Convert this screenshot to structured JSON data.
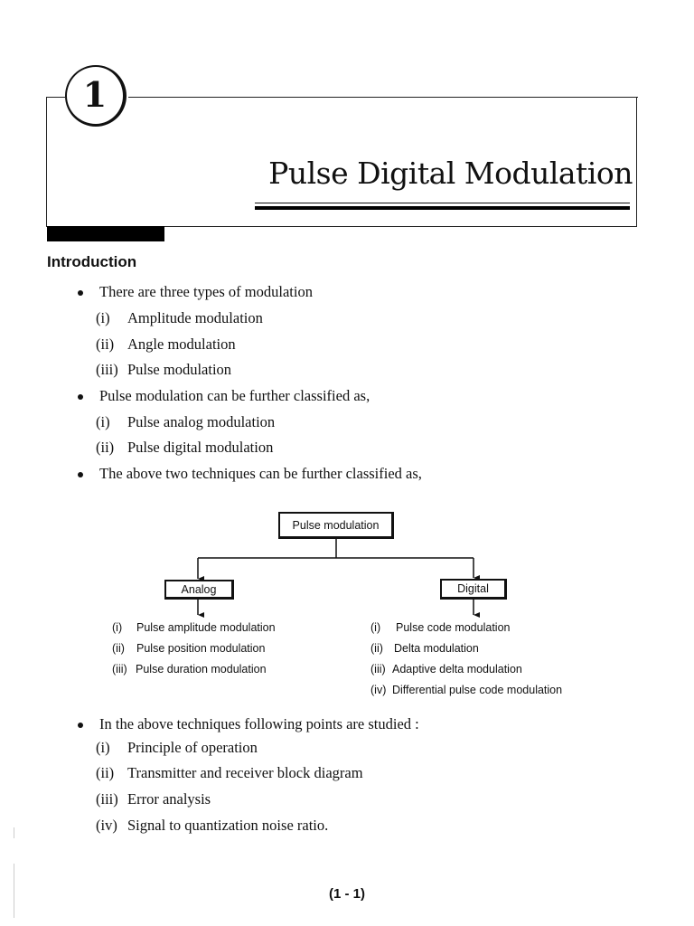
{
  "chapter": {
    "number": "1",
    "title": "Pulse Digital Modulation"
  },
  "introduction": {
    "heading": "Introduction",
    "bullets": [
      {
        "text": "There are three types of modulation",
        "items": [
          {
            "label": "(i)",
            "text": "Amplitude modulation"
          },
          {
            "label": "(ii)",
            "text": "Angle modulation"
          },
          {
            "label": "(iii)",
            "text": "Pulse modulation"
          }
        ]
      },
      {
        "text": "Pulse modulation can be further classified as,",
        "items": [
          {
            "label": "(i)",
            "text": "Pulse analog modulation"
          },
          {
            "label": "(ii)",
            "text": "Pulse digital modulation"
          }
        ]
      },
      {
        "text": "The above two techniques can be further classified as,",
        "items": []
      },
      {
        "text": "In the above techniques following points are studied :",
        "items": [
          {
            "label": "(i)",
            "text": "Principle of operation"
          },
          {
            "label": "(ii)",
            "text": "Transmitter and receiver block diagram"
          },
          {
            "label": "(iii)",
            "text": "Error analysis"
          },
          {
            "label": "(iv)",
            "text": "Signal to quantization noise ratio."
          }
        ]
      }
    ]
  },
  "diagram": {
    "root": "Pulse modulation",
    "analog": {
      "label": "Analog",
      "items": [
        {
          "label": "(i)",
          "text": "Pulse amplitude modulation"
        },
        {
          "label": "(ii)",
          "text": "Pulse position modulation"
        },
        {
          "label": "(iii)",
          "text": "Pulse duration modulation"
        }
      ]
    },
    "digital": {
      "label": "Digital",
      "items": [
        {
          "label": "(i)",
          "text": "Pulse code modulation"
        },
        {
          "label": "(ii)",
          "text": "Delta modulation"
        },
        {
          "label": "(iii)",
          "text": "Adaptive delta modulation"
        },
        {
          "label": "(iv)",
          "text": "Differential pulse code modulation"
        }
      ]
    }
  },
  "footer": {
    "page_number": "(1 - 1)"
  }
}
